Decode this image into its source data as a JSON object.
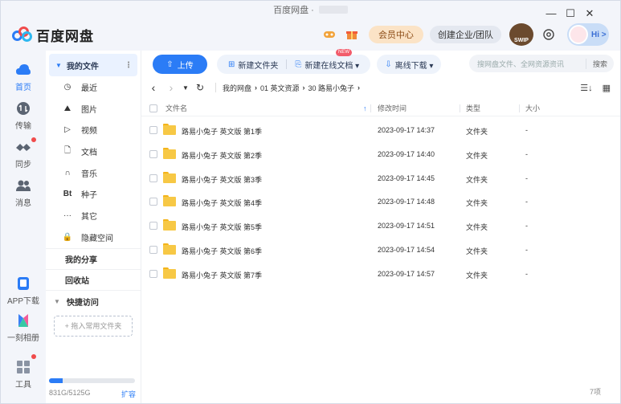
{
  "window": {
    "title": "百度网盘 ·",
    "controls": [
      "—",
      "☐",
      "✕"
    ]
  },
  "header": {
    "logo_text": "百度网盘",
    "vip_label": "会员中心",
    "enterprise_label": "创建企业/团队",
    "badge_label": "SWIP",
    "avatar_hi": "Hi >"
  },
  "rail": {
    "items": [
      {
        "label": "首页",
        "icon": "cloud-icon"
      },
      {
        "label": "传输",
        "icon": "transfer-icon"
      },
      {
        "label": "同步",
        "icon": "sync-icon"
      },
      {
        "label": "消息",
        "icon": "message-icon"
      },
      {
        "label": "APP下载",
        "icon": "phone-icon"
      },
      {
        "label": "一刻相册",
        "icon": "album-icon"
      },
      {
        "label": "工具",
        "icon": "tools-icon"
      }
    ]
  },
  "nav": {
    "my_files": "我的文件",
    "items": [
      {
        "label": "最近",
        "icon": "◷"
      },
      {
        "label": "图片",
        "icon": "⛰"
      },
      {
        "label": "视频",
        "icon": "▷"
      },
      {
        "label": "文档",
        "icon": "🗋"
      },
      {
        "label": "音乐",
        "icon": "∩"
      },
      {
        "label": "种子",
        "icon": "Bt"
      },
      {
        "label": "其它",
        "icon": "···"
      },
      {
        "label": "隐藏空间",
        "icon": "🔒"
      }
    ],
    "my_share": "我的分享",
    "recycle": "回收站",
    "quick_access": "快捷访问",
    "drop_zone": "+ 拖入常用文件夹",
    "quota_text": "831G/5125G",
    "quota_fraction": 0.162,
    "expand_label": "扩容"
  },
  "toolbar": {
    "upload": "上传",
    "new_folder": "新建文件夹",
    "new_online_doc": "新建在线文档 ▾",
    "new_tag": "NEW",
    "offline_download": "离线下载 ▾",
    "search_placeholder": "搜网盘文件、全网资源资讯",
    "search_button": "搜索"
  },
  "path": {
    "crumbs": [
      "我的网盘",
      "01 英文资源",
      "30 路易小兔子"
    ]
  },
  "table": {
    "headers": {
      "name": "文件名",
      "time": "修改时间",
      "type": "类型",
      "size": "大小"
    },
    "rows": [
      {
        "name": "路易小兔子 英文版 第1季",
        "time": "2023-09-17 14:37",
        "type": "文件夹",
        "size": "-"
      },
      {
        "name": "路易小兔子 英文版 第2季",
        "time": "2023-09-17 14:40",
        "type": "文件夹",
        "size": "-"
      },
      {
        "name": "路易小兔子 英文版 第3季",
        "time": "2023-09-17 14:45",
        "type": "文件夹",
        "size": "-"
      },
      {
        "name": "路易小兔子 英文版 第4季",
        "time": "2023-09-17 14:48",
        "type": "文件夹",
        "size": "-"
      },
      {
        "name": "路易小兔子 英文版 第5季",
        "time": "2023-09-17 14:51",
        "type": "文件夹",
        "size": "-"
      },
      {
        "name": "路易小兔子 英文版 第6季",
        "time": "2023-09-17 14:54",
        "type": "文件夹",
        "size": "-"
      },
      {
        "name": "路易小兔子 英文版 第7季",
        "time": "2023-09-17 14:57",
        "type": "文件夹",
        "size": "-"
      }
    ],
    "count": "7项"
  },
  "colors": {
    "accent": "#2b7cf6",
    "folder": "#f7c845",
    "vip_bg": "#fbe3c6"
  }
}
